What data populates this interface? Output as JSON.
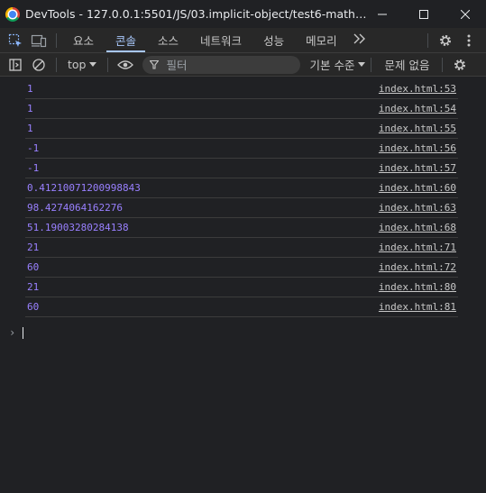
{
  "window": {
    "title": "DevTools - 127.0.0.1:5501/JS/03.implicit-object/test6-math/index.ht...",
    "controls": [
      "minimize",
      "maximize",
      "close"
    ]
  },
  "tabs": [
    {
      "label": "요소",
      "active": false
    },
    {
      "label": "콘솔",
      "active": true
    },
    {
      "label": "소스",
      "active": false
    },
    {
      "label": "네트워크",
      "active": false
    },
    {
      "label": "성능",
      "active": false
    },
    {
      "label": "메모리",
      "active": false
    }
  ],
  "toolbar": {
    "context": "top",
    "filter_placeholder": "필터",
    "levels": "기본 수준",
    "issues": "문제 없음"
  },
  "console": {
    "messages": [
      {
        "value": "1",
        "source": "index.html:53"
      },
      {
        "value": "1",
        "source": "index.html:54"
      },
      {
        "value": "1",
        "source": "index.html:55"
      },
      {
        "value": "-1",
        "source": "index.html:56"
      },
      {
        "value": "-1",
        "source": "index.html:57"
      },
      {
        "value": "0.41210071200998843",
        "source": "index.html:60"
      },
      {
        "value": "98.4274064162276",
        "source": "index.html:63"
      },
      {
        "value": "51.19003280284138",
        "source": "index.html:68"
      },
      {
        "value": "21",
        "source": "index.html:71"
      },
      {
        "value": "60",
        "source": "index.html:72"
      },
      {
        "value": "21",
        "source": "index.html:80"
      },
      {
        "value": "60",
        "source": "index.html:81"
      }
    ]
  },
  "colors": {
    "background": "#202124",
    "number_value": "#9980ff",
    "active_tab": "#a8c7fa"
  }
}
